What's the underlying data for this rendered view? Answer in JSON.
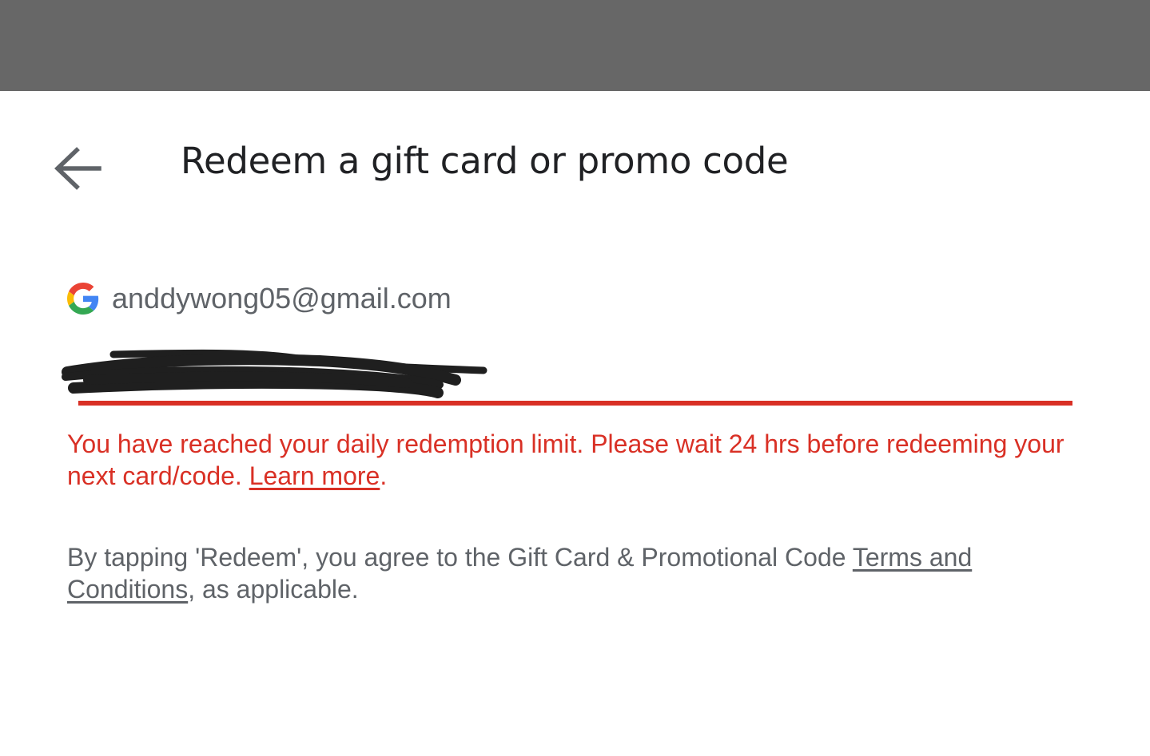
{
  "header": {
    "back_icon": "arrow-left-icon",
    "title": "Redeem a gift card or promo code"
  },
  "account": {
    "logo_icon": "google-g-logo",
    "email": "anddywong05@gmail.com"
  },
  "code_input": {
    "value": "",
    "placeholder": "",
    "underline_color": "#d93025"
  },
  "error": {
    "message": "You have reached your daily redemption limit. Please wait 24 hrs before redeeming your next card/code. ",
    "link_label": "Learn more",
    "suffix": ".",
    "color": "#d93025"
  },
  "terms": {
    "prefix": "By tapping 'Redeem', you agree to the Gift Card & Promotional Code ",
    "link_label": "Terms and Conditions",
    "suffix": ", as applicable."
  },
  "colors": {
    "status_bar": "#676767",
    "title_text": "#202124",
    "secondary_text": "#5f6368"
  }
}
